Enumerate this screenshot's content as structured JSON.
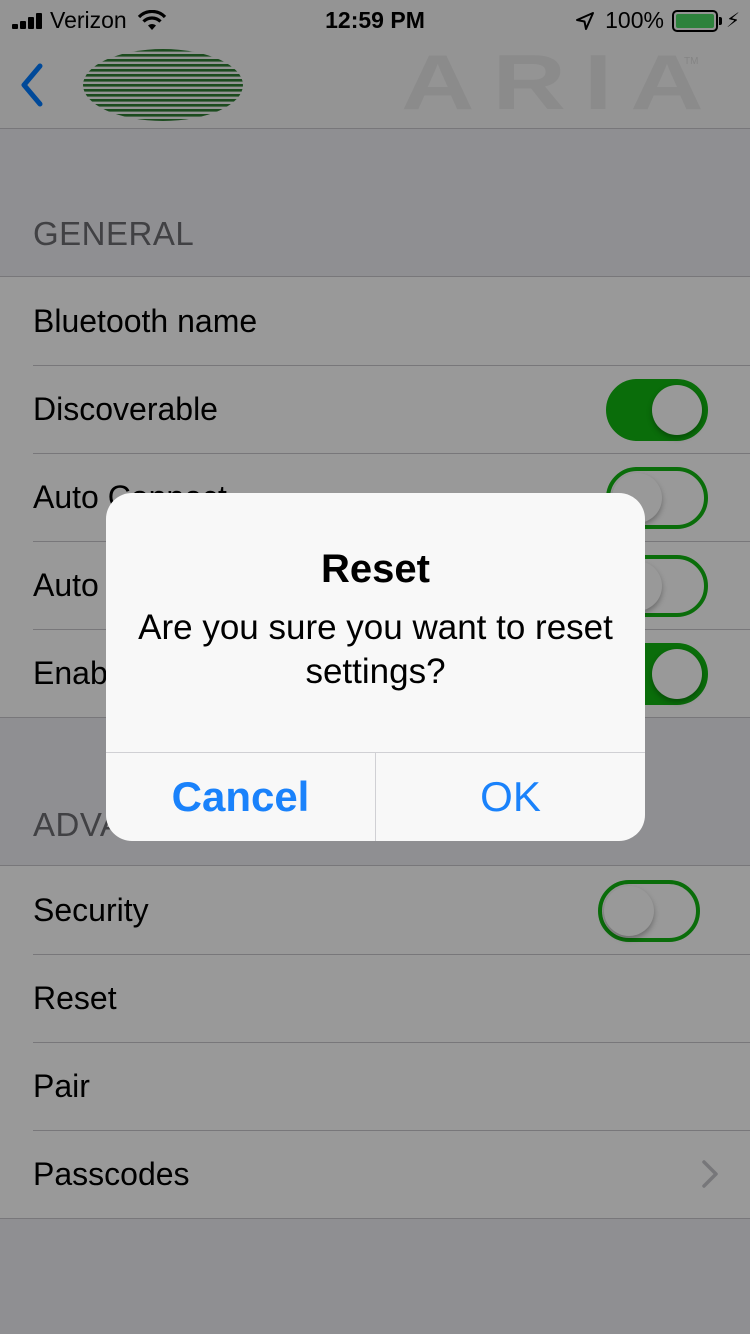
{
  "status_bar": {
    "carrier": "Verizon",
    "time": "12:59 PM",
    "battery_text": "100%",
    "battery_color": "#4cd964"
  },
  "nav": {
    "back_icon": "chevron-left-icon",
    "brand": "ARIA",
    "brand_tm": "TM",
    "logo_color": "#2e7d32"
  },
  "sections": {
    "general": {
      "header": "GENERAL",
      "rows": [
        {
          "label": "Bluetooth name"
        },
        {
          "label": "Discoverable",
          "toggle": "on"
        },
        {
          "label": "Auto Connect",
          "toggle": "off"
        },
        {
          "label": "Auto",
          "toggle": "off"
        },
        {
          "label": "Enab",
          "toggle": "on"
        }
      ]
    },
    "advanced": {
      "header": "ADVA",
      "rows": [
        {
          "label": "Security",
          "toggle": "off"
        },
        {
          "label": "Reset"
        },
        {
          "label": "Pair"
        },
        {
          "label": "Passcodes",
          "accessory": "chevron-right-icon"
        }
      ]
    }
  },
  "alert": {
    "title": "Reset",
    "message": "Are you sure you want to reset settings?",
    "cancel_label": "Cancel",
    "ok_label": "OK"
  },
  "colors": {
    "toggle_green": "#11b611",
    "ios_blue": "#1a82fb",
    "chevron": "#c7c7cc"
  }
}
